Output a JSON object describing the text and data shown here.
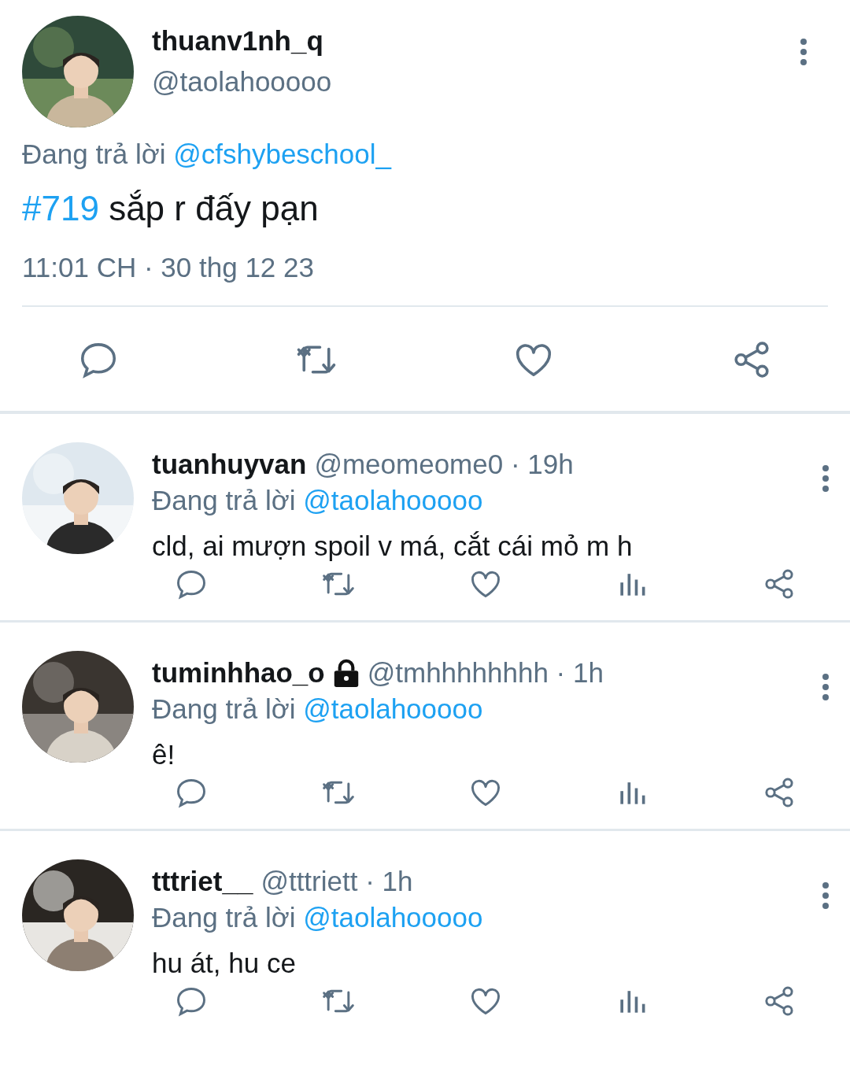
{
  "main_tweet": {
    "name": "thuanv1nh_q",
    "handle": "@taolahooooo",
    "reply_prefix": "Đang trả lời",
    "reply_to": "@cfshybeschool_",
    "hashtag": "#719",
    "text": "sắp r đấy pạn",
    "time": "11:01 CH · 30 thg 12 23"
  },
  "replies": [
    {
      "name": "tuanhuyvan",
      "locked": false,
      "meta": "@meomeome0 · 19h",
      "reply_prefix": "Đang trả lời",
      "reply_to": "@taolahooooo",
      "text": "cld, ai mượn spoil v má, cắt cái mỏ m h"
    },
    {
      "name": "tuminhhao_o",
      "locked": true,
      "meta": "@tmhhhhhhhh · 1h",
      "reply_prefix": "Đang trả lời",
      "reply_to": "@taolahooooo",
      "text": "ê!"
    },
    {
      "name": "tttriet__",
      "locked": false,
      "meta": "@tttriett · 1h",
      "reply_prefix": "Đang trả lời",
      "reply_to": "@taolahooooo",
      "text": "hu át, hu ce"
    }
  ]
}
